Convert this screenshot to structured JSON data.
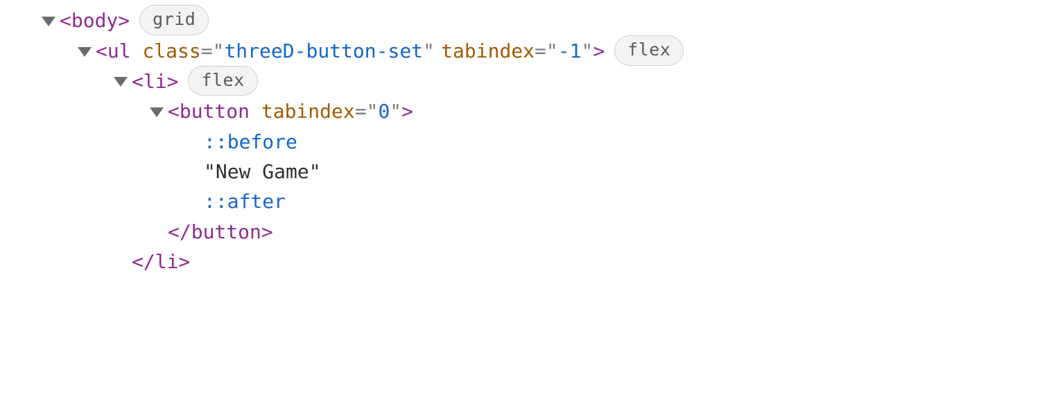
{
  "rows": [
    {
      "depth": 0,
      "arrow": true,
      "segments": [
        {
          "cls": "t-angle",
          "text": "<body>"
        }
      ],
      "badge": "grid"
    },
    {
      "depth": 1,
      "arrow": true,
      "segments": [
        {
          "cls": "t-angle",
          "text": "<ul "
        },
        {
          "cls": "t-attr",
          "text": "class"
        },
        {
          "cls": "t-eq",
          "text": "=\""
        },
        {
          "cls": "t-string",
          "text": "threeD-button-set"
        },
        {
          "cls": "t-eq",
          "text": "\""
        },
        {
          "cls": "gap",
          "text": " "
        },
        {
          "cls": "t-attr",
          "text": "tabindex"
        },
        {
          "cls": "t-eq",
          "text": "=\""
        },
        {
          "cls": "t-string",
          "text": "-1"
        },
        {
          "cls": "t-eq",
          "text": "\""
        },
        {
          "cls": "t-angle",
          "text": ">"
        }
      ],
      "badge": "flex"
    },
    {
      "depth": 2,
      "arrow": true,
      "segments": [
        {
          "cls": "t-angle",
          "text": "<li>"
        }
      ],
      "badge": "flex"
    },
    {
      "depth": 3,
      "arrow": true,
      "segments": [
        {
          "cls": "t-angle",
          "text": "<button "
        },
        {
          "cls": "t-attr",
          "text": "tabindex"
        },
        {
          "cls": "t-eq",
          "text": "=\""
        },
        {
          "cls": "t-string",
          "text": "0"
        },
        {
          "cls": "t-eq",
          "text": "\""
        },
        {
          "cls": "t-angle",
          "text": ">"
        }
      ],
      "badge": null
    },
    {
      "depth": 4,
      "arrow": false,
      "segments": [
        {
          "cls": "t-pseudo",
          "text": "::before"
        }
      ],
      "badge": null
    },
    {
      "depth": 4,
      "arrow": false,
      "segments": [
        {
          "cls": "t-quote",
          "text": "\""
        },
        {
          "cls": "t-text",
          "text": "New Game"
        },
        {
          "cls": "t-quote",
          "text": "\""
        }
      ],
      "badge": null
    },
    {
      "depth": 4,
      "arrow": false,
      "segments": [
        {
          "cls": "t-pseudo",
          "text": "::after"
        }
      ],
      "badge": null
    },
    {
      "depth": 3,
      "arrow": false,
      "segments": [
        {
          "cls": "t-angle",
          "text": "</button>"
        }
      ],
      "badge": null
    },
    {
      "depth": 2,
      "arrow": false,
      "segments": [
        {
          "cls": "t-angle",
          "text": "</li>"
        }
      ],
      "badge": null
    }
  ]
}
